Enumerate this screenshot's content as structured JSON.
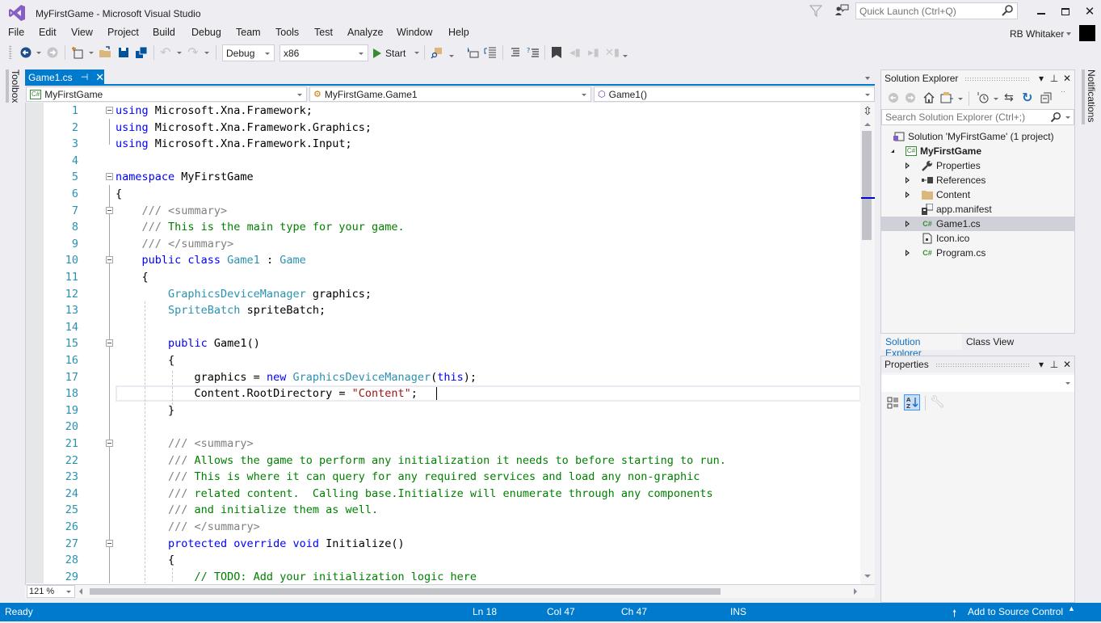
{
  "window": {
    "title": "MyFirstGame - Microsoft Visual Studio",
    "quick_launch_placeholder": "Quick Launch (Ctrl+Q)",
    "user_name": "RB Whitaker"
  },
  "menu": [
    "File",
    "Edit",
    "View",
    "Project",
    "Build",
    "Debug",
    "Team",
    "Tools",
    "Test",
    "Analyze",
    "Window",
    "Help"
  ],
  "toolbar": {
    "configuration": "Debug",
    "platform": "x86",
    "start_label": "Start"
  },
  "side_tabs": {
    "left": "Toolbox",
    "right": "Notifications"
  },
  "editor": {
    "tab_label": "Game1.cs",
    "nav_project": "MyFirstGame",
    "nav_type": "MyFirstGame.Game1",
    "nav_member": "Game1()",
    "zoom_level": "121 %",
    "lines": [
      {
        "n": "1",
        "tokens": [
          [
            "kw",
            "using"
          ],
          [
            "",
            "Microsoft.Xna.Framework;"
          ]
        ]
      },
      {
        "n": "2",
        "tokens": [
          [
            "kw",
            "using"
          ],
          [
            "",
            "Microsoft.Xna.Framework.Graphics;"
          ]
        ]
      },
      {
        "n": "3",
        "tokens": [
          [
            "kw",
            "using"
          ],
          [
            "",
            "Microsoft.Xna.Framework.Input;"
          ]
        ]
      },
      {
        "n": "4",
        "tokens": []
      },
      {
        "n": "5",
        "tokens": [
          [
            "kw",
            "namespace"
          ],
          [
            "",
            "MyFirstGame"
          ]
        ]
      },
      {
        "n": "6",
        "tokens": [
          [
            "",
            "{"
          ]
        ]
      },
      {
        "n": "7",
        "tokens": [
          [
            "cmg",
            "    /// <summary>"
          ]
        ]
      },
      {
        "n": "8",
        "tokens": [
          [
            "cmg",
            "    ///"
          ],
          [
            "cm",
            "This is the main type for your game."
          ]
        ]
      },
      {
        "n": "9",
        "tokens": [
          [
            "cmg",
            "    /// </summary>"
          ]
        ]
      },
      {
        "n": "10",
        "tokens": [
          [
            "kw",
            "    public class"
          ],
          [
            "ty",
            "Game1"
          ],
          [
            "",
            ":"
          ],
          [
            "ty",
            "Game"
          ]
        ]
      },
      {
        "n": "11",
        "tokens": [
          [
            "",
            "    {"
          ]
        ]
      },
      {
        "n": "12",
        "tokens": [
          [
            "ty",
            "        GraphicsDeviceManager"
          ],
          [
            "",
            "graphics;"
          ]
        ]
      },
      {
        "n": "13",
        "tokens": [
          [
            "ty",
            "        SpriteBatch"
          ],
          [
            "",
            "spriteBatch;"
          ]
        ]
      },
      {
        "n": "14",
        "tokens": []
      },
      {
        "n": "15",
        "tokens": [
          [
            "kw",
            "        public"
          ],
          [
            "",
            "Game1()"
          ]
        ]
      },
      {
        "n": "16",
        "tokens": [
          [
            "",
            "        {"
          ]
        ]
      },
      {
        "n": "17",
        "tokens": [
          [
            "",
            "            graphics ="
          ],
          [
            "kw",
            "new"
          ],
          [
            "ty",
            "GraphicsDeviceManager"
          ],
          [
            "",
            "("
          ],
          [
            "kw",
            "this"
          ],
          [
            "",
            ");"
          ]
        ]
      },
      {
        "n": "18",
        "tokens": [
          [
            "",
            "            Content.RootDirectory ="
          ],
          [
            "str",
            "\"Content\""
          ],
          [
            "",
            ";"
          ]
        ]
      },
      {
        "n": "19",
        "tokens": [
          [
            "",
            "        }"
          ]
        ]
      },
      {
        "n": "20",
        "tokens": []
      },
      {
        "n": "21",
        "tokens": [
          [
            "cmg",
            "        /// <summary>"
          ]
        ]
      },
      {
        "n": "22",
        "tokens": [
          [
            "cmg",
            "        ///"
          ],
          [
            "cm",
            "Allows the game to perform any initialization it needs to before starting to run."
          ]
        ]
      },
      {
        "n": "23",
        "tokens": [
          [
            "cmg",
            "        ///"
          ],
          [
            "cm",
            "This is where it can query for any required services and load any non-graphic"
          ]
        ]
      },
      {
        "n": "24",
        "tokens": [
          [
            "cmg",
            "        ///"
          ],
          [
            "cm",
            "related content.  Calling base.Initialize will enumerate through any components"
          ]
        ]
      },
      {
        "n": "25",
        "tokens": [
          [
            "cmg",
            "        ///"
          ],
          [
            "cm",
            "and initialize them as well."
          ]
        ]
      },
      {
        "n": "26",
        "tokens": [
          [
            "cmg",
            "        /// </summary>"
          ]
        ]
      },
      {
        "n": "27",
        "tokens": [
          [
            "kw",
            "        protected override void"
          ],
          [
            "",
            "Initialize()"
          ]
        ]
      },
      {
        "n": "28",
        "tokens": [
          [
            "",
            "        {"
          ]
        ]
      },
      {
        "n": "29",
        "tokens": [
          [
            "cm",
            "            // TODO: Add your initialization logic here"
          ]
        ]
      }
    ]
  },
  "solution_explorer": {
    "title": "Solution Explorer",
    "search_placeholder": "Search Solution Explorer (Ctrl+;)",
    "tree": [
      {
        "label": "Solution 'MyFirstGame' (1 project)",
        "depth": 0,
        "expander": "none",
        "icon": "solution-icon",
        "bold": false,
        "selected": false
      },
      {
        "label": "MyFirstGame",
        "depth": 1,
        "expander": "open",
        "icon": "csharp-project-icon",
        "bold": true,
        "selected": false
      },
      {
        "label": "Properties",
        "depth": 2,
        "expander": "closed",
        "icon": "wrench-icon",
        "bold": false,
        "selected": false
      },
      {
        "label": "References",
        "depth": 2,
        "expander": "closed",
        "icon": "references-icon",
        "bold": false,
        "selected": false
      },
      {
        "label": "Content",
        "depth": 2,
        "expander": "closed",
        "icon": "folder-icon",
        "bold": false,
        "selected": false
      },
      {
        "label": "app.manifest",
        "depth": 2,
        "expander": "none",
        "icon": "manifest-icon",
        "bold": false,
        "selected": false
      },
      {
        "label": "Game1.cs",
        "depth": 2,
        "expander": "closed",
        "icon": "csharp-file-icon",
        "bold": false,
        "selected": true
      },
      {
        "label": "Icon.ico",
        "depth": 2,
        "expander": "none",
        "icon": "ico-file-icon",
        "bold": false,
        "selected": false
      },
      {
        "label": "Program.cs",
        "depth": 2,
        "expander": "closed",
        "icon": "csharp-file-icon",
        "bold": false,
        "selected": false
      }
    ],
    "tabs": [
      "Solution Explorer",
      "Class View"
    ]
  },
  "properties": {
    "title": "Properties"
  },
  "statusbar": {
    "state": "Ready",
    "line": "Ln 18",
    "col": "Col 47",
    "ch": "Ch 47",
    "mode": "INS",
    "source_control": "Add to Source Control"
  },
  "colors": {
    "accent": "#007acc",
    "keyword": "#0000ff",
    "type": "#2b91af",
    "comment": "#008000",
    "string": "#a31515"
  }
}
